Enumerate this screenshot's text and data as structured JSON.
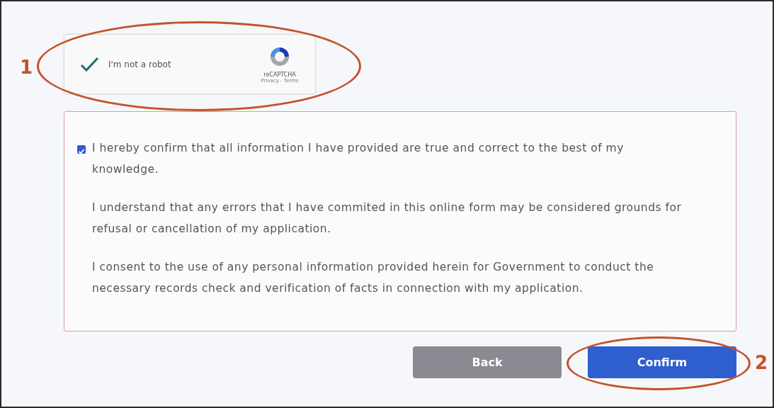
{
  "recaptcha": {
    "checked": true,
    "label": "I'm not a robot",
    "brand": "reCAPTCHA",
    "links": "Privacy - Terms"
  },
  "consent": {
    "checked": true,
    "paragraphs": [
      "I hereby confirm that all information I have provided are true and correct to the best of my knowledge.",
      "I understand that any errors that I have commited in this online form may be considered grounds for refusal or cancellation of my application.",
      "I consent to the use of any personal information provided herein for Government to conduct the necessary records check and verification of facts in connection with my application."
    ]
  },
  "buttons": [
    {
      "label": "Back",
      "kind": "secondary"
    },
    {
      "label": "Confirm",
      "kind": "primary"
    }
  ],
  "annotations": [
    {
      "number": "1"
    },
    {
      "number": "2"
    }
  ]
}
